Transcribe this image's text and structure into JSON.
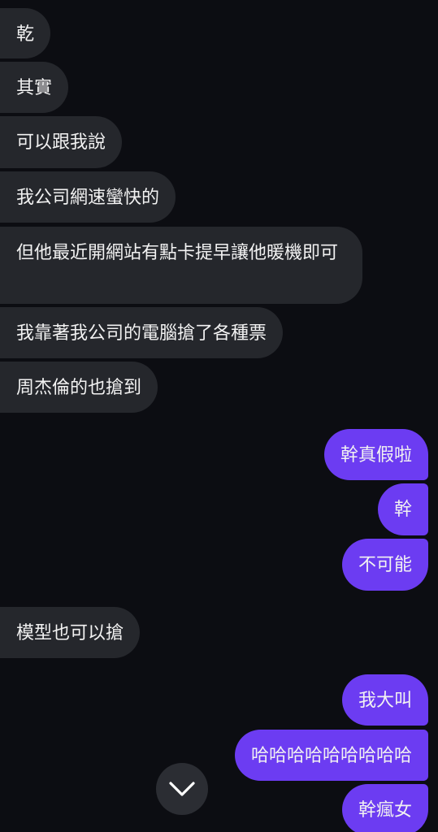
{
  "incoming": [
    "乾",
    "其實",
    "可以跟我說",
    "我公司網速蠻快的",
    "但他最近開網站有點卡提早讓他暖機即可",
    "我靠著我公司的電腦搶了各種票",
    "周杰倫的也搶到",
    "模型也可以搶"
  ],
  "outgoing": [
    "幹真假啦",
    "幹",
    "不可能",
    "我大叫",
    "哈哈哈哈哈哈哈哈哈",
    "幹瘋女"
  ],
  "scroll_button": {
    "icon": "chevron-down-icon"
  },
  "colors": {
    "background": "#0c0d12",
    "incoming_bubble": "#25272c",
    "outgoing_bubble": "#6c3cf2"
  }
}
